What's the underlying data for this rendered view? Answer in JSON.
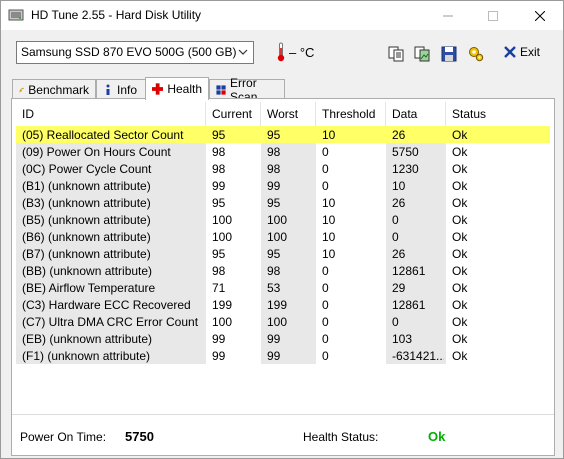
{
  "window": {
    "title": "HD Tune 2.55 - Hard Disk Utility",
    "min_icon": "minimize-icon",
    "max_icon": "maximize-icon",
    "close_icon": "close-icon"
  },
  "toolbar": {
    "drive": "Samsung SSD 870 EVO 500G (500 GB)",
    "temperature": "– °C",
    "exit_label": "Exit"
  },
  "tabs": [
    {
      "label": "Benchmark",
      "icon": "benchmark-icon"
    },
    {
      "label": "Info",
      "icon": "info-icon"
    },
    {
      "label": "Health",
      "icon": "health-cross-icon"
    },
    {
      "label": "Error Scan",
      "icon": "error-scan-icon"
    }
  ],
  "table": {
    "headers": [
      "ID",
      "Current",
      "Worst",
      "Threshold",
      "Data",
      "Status"
    ],
    "rows": [
      [
        "(05) Reallocated Sector Count",
        "95",
        "95",
        "10",
        "26",
        "Ok"
      ],
      [
        "(09) Power On Hours Count",
        "98",
        "98",
        "0",
        "5750",
        "Ok"
      ],
      [
        "(0C) Power Cycle Count",
        "98",
        "98",
        "0",
        "1230",
        "Ok"
      ],
      [
        "(B1) (unknown attribute)",
        "99",
        "99",
        "0",
        "10",
        "Ok"
      ],
      [
        "(B3) (unknown attribute)",
        "95",
        "95",
        "10",
        "26",
        "Ok"
      ],
      [
        "(B5) (unknown attribute)",
        "100",
        "100",
        "10",
        "0",
        "Ok"
      ],
      [
        "(B6) (unknown attribute)",
        "100",
        "100",
        "10",
        "0",
        "Ok"
      ],
      [
        "(B7) (unknown attribute)",
        "95",
        "95",
        "10",
        "26",
        "Ok"
      ],
      [
        "(BB) (unknown attribute)",
        "98",
        "98",
        "0",
        "12861",
        "Ok"
      ],
      [
        "(BE) Airflow Temperature",
        "71",
        "53",
        "0",
        "29",
        "Ok"
      ],
      [
        "(C3) Hardware ECC Recovered",
        "199",
        "199",
        "0",
        "12861",
        "Ok"
      ],
      [
        "(C7) Ultra DMA CRC Error Count",
        "100",
        "100",
        "0",
        "0",
        "Ok"
      ],
      [
        "(EB) (unknown attribute)",
        "99",
        "99",
        "0",
        "103",
        "Ok"
      ],
      [
        "(F1) (unknown attribute)",
        "99",
        "99",
        "0",
        "-631421...",
        "Ok"
      ]
    ]
  },
  "footer": {
    "power_on_label": "Power On Time:",
    "power_on_value": "5750",
    "health_label": "Health Status:",
    "health_value": "Ok"
  },
  "colors": {
    "highlight": "#ffff66",
    "ok_green": "#00b000",
    "shade": "#e8e8e8"
  }
}
